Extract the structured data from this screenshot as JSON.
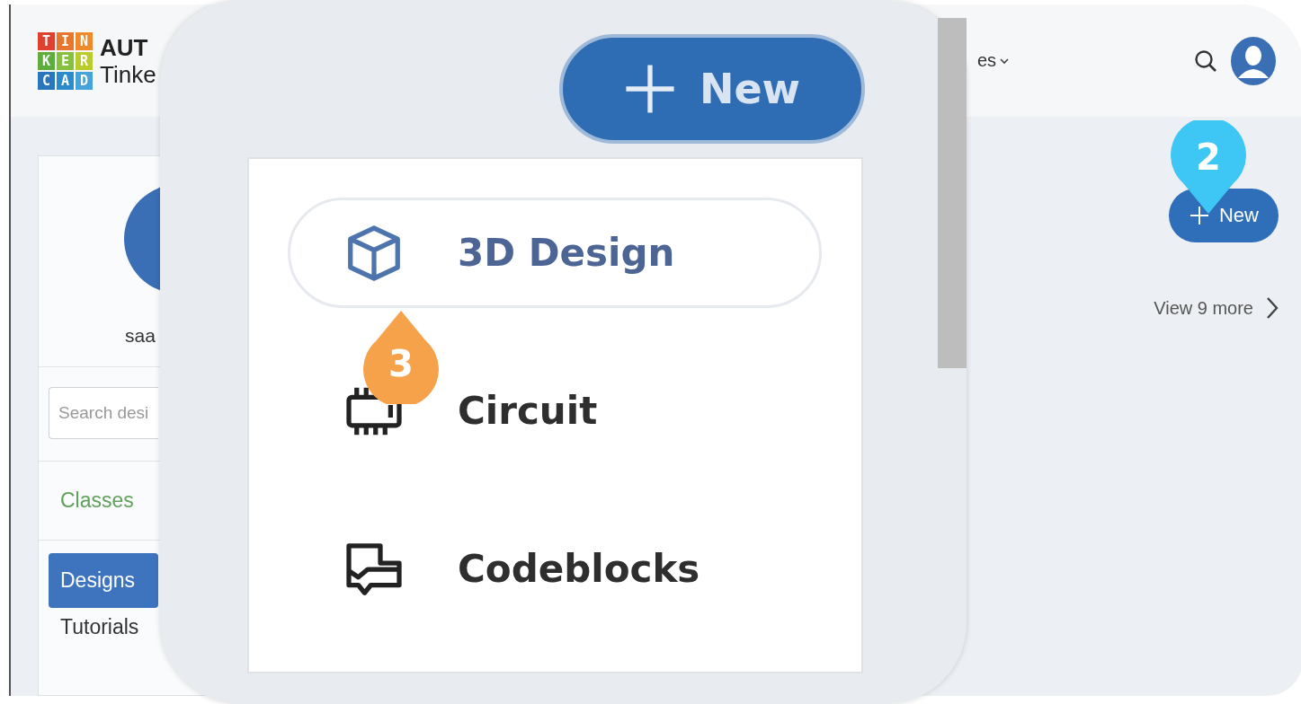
{
  "logo": {
    "tiles": [
      {
        "letter": "T",
        "color": "#e0412f"
      },
      {
        "letter": "I",
        "color": "#e8772e"
      },
      {
        "letter": "N",
        "color": "#ef8a2a"
      },
      {
        "letter": "K",
        "color": "#5eae3f"
      },
      {
        "letter": "E",
        "color": "#86c03f"
      },
      {
        "letter": "R",
        "color": "#b9cc2c"
      },
      {
        "letter": "C",
        "color": "#2a76bd"
      },
      {
        "letter": "A",
        "color": "#2b8bcd"
      },
      {
        "letter": "D",
        "color": "#46a4db"
      }
    ]
  },
  "brand": {
    "line_1": "AUT",
    "line_2": "Tinke"
  },
  "header": {
    "menu_label": "es"
  },
  "sidebar": {
    "user_name": "saa",
    "search": {
      "placeholder": "Search desi"
    },
    "items": [
      {
        "kind": "link",
        "label": "Classes",
        "selected": false
      },
      {
        "kind": "nav",
        "label": "Designs",
        "selected": true
      },
      {
        "kind": "nav",
        "label": "Tutorials",
        "selected": false
      }
    ]
  },
  "new_button": {
    "label": "New"
  },
  "view_more": "View 9 more",
  "callout": {
    "new_button": {
      "label": "New"
    },
    "menu": [
      {
        "kind": "cube",
        "label": "3D Design",
        "selected": true
      },
      {
        "kind": "chip",
        "label": "Circuit",
        "selected": false
      },
      {
        "kind": "blocks",
        "label": "Codeblocks",
        "selected": false
      }
    ]
  },
  "markers": [
    {
      "kind": "down",
      "label": "2",
      "color": "#3ec7f4"
    },
    {
      "kind": "up",
      "label": "3",
      "color": "#f6a24b"
    }
  ]
}
